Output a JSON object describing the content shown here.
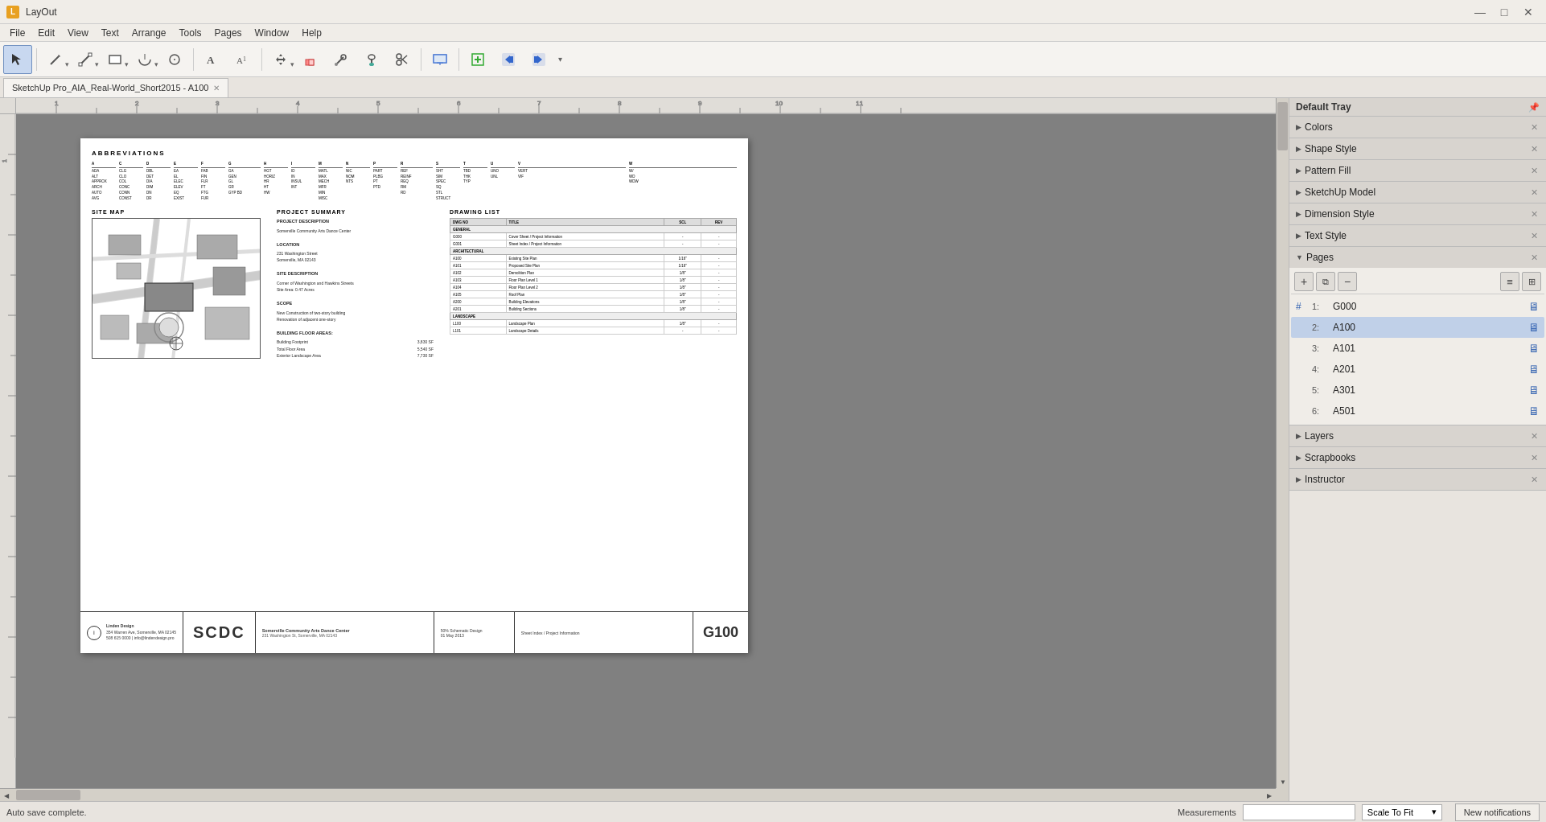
{
  "app": {
    "title": "LayOut",
    "icon_text": "L"
  },
  "window_controls": {
    "minimize": "—",
    "maximize": "□",
    "close": "✕"
  },
  "menu": {
    "items": [
      "File",
      "Edit",
      "View",
      "Text",
      "Arrange",
      "Tools",
      "Pages",
      "Window",
      "Help"
    ]
  },
  "toolbar": {
    "tools": [
      {
        "name": "select-tool",
        "icon": "↖",
        "label": "Select"
      },
      {
        "name": "pencil-tool",
        "icon": "✏",
        "label": "Pencil"
      },
      {
        "name": "line-tool",
        "icon": "╱",
        "label": "Line"
      },
      {
        "name": "shape-tool",
        "icon": "⬜",
        "label": "Shape"
      },
      {
        "name": "arc-tool",
        "icon": "◔",
        "label": "Arc"
      },
      {
        "name": "circle-tool",
        "icon": "◎",
        "label": "Circle"
      },
      {
        "name": "text-tool",
        "icon": "A",
        "label": "Text"
      },
      {
        "name": "text2-tool",
        "icon": "A",
        "label": "Scaled Text"
      },
      {
        "name": "move-tool",
        "icon": "✛",
        "label": "Move"
      },
      {
        "name": "eraser-tool",
        "icon": "▭",
        "label": "Eraser"
      },
      {
        "name": "eyedropper-tool",
        "icon": "✒",
        "label": "Eyedropper"
      },
      {
        "name": "paint-tool",
        "icon": "/",
        "label": "Paint"
      },
      {
        "name": "scissors-tool",
        "icon": "✂",
        "label": "Scissors"
      },
      {
        "name": "screen-tool",
        "icon": "🖥",
        "label": "Screen"
      },
      {
        "name": "insert-tool",
        "icon": "➕",
        "label": "Insert"
      },
      {
        "name": "nav-back",
        "icon": "⬅",
        "label": "Back"
      },
      {
        "name": "nav-forward",
        "icon": "➡",
        "label": "Forward"
      }
    ]
  },
  "tab": {
    "label": "SketchUp Pro_AIA_Real-World_Short2015 - A100",
    "close_icon": "✕"
  },
  "canvas": {
    "background_color": "#808080"
  },
  "right_panel": {
    "title": "Default Tray",
    "pin_icon": "📌",
    "sections": [
      {
        "id": "colors",
        "label": "Colors",
        "expanded": false,
        "arrow": "▶"
      },
      {
        "id": "shape-style",
        "label": "Shape Style",
        "expanded": false,
        "arrow": "▶"
      },
      {
        "id": "pattern-fill",
        "label": "Pattern Fill",
        "expanded": false,
        "arrow": "▶"
      },
      {
        "id": "sketchup-model",
        "label": "SketchUp Model",
        "expanded": false,
        "arrow": "▶"
      },
      {
        "id": "dimension-style",
        "label": "Dimension Style",
        "expanded": false,
        "arrow": "▶"
      },
      {
        "id": "text-style",
        "label": "Text Style",
        "expanded": false,
        "arrow": "▶"
      },
      {
        "id": "pages",
        "label": "Pages",
        "expanded": true,
        "arrow": "▼"
      },
      {
        "id": "layers",
        "label": "Layers",
        "expanded": false,
        "arrow": "▶"
      },
      {
        "id": "scrapbooks",
        "label": "Scrapbooks",
        "expanded": false,
        "arrow": "▶"
      },
      {
        "id": "instructor",
        "label": "Instructor",
        "expanded": false,
        "arrow": "▶"
      }
    ]
  },
  "pages": {
    "toolbar": {
      "add_icon": "+",
      "duplicate_icon": "⧉",
      "remove_icon": "−",
      "list_view_icon": "≡",
      "grid_view_icon": "⊞"
    },
    "items": [
      {
        "num": "1:",
        "label": "G000",
        "active": false,
        "hash": true
      },
      {
        "num": "2:",
        "label": "A100",
        "active": true,
        "hash": false
      },
      {
        "num": "3:",
        "label": "A101",
        "active": false,
        "hash": false
      },
      {
        "num": "4:",
        "label": "A201",
        "active": false,
        "hash": false
      },
      {
        "num": "5:",
        "label": "A301",
        "active": false,
        "hash": false
      },
      {
        "num": "6:",
        "label": "A501",
        "active": false,
        "hash": false
      }
    ],
    "monitor_icon": "🖥"
  },
  "page_document": {
    "abbreviations_title": "ABBREVIATIONS",
    "site_map_title": "SITE MAP",
    "project_summary_title": "PROJECT SUMMARY",
    "drawing_list_title": "DRAWING LIST",
    "title_block": {
      "company_name": "Linden Design",
      "company_address": "354 Warren Ave, Somerville, MA 02145\n508 615 0000 | info@lindendesign.pro",
      "scdc_text": "SCDC",
      "project_name": "Somerville Community Arts Dance Center",
      "project_address": "231 Washington St, Somerville, MA 02143",
      "phase": "50% Schematic Design",
      "date": "01 May 2013",
      "sheet_label": "Sheet Index / Project Information",
      "sheet_number": "G100"
    }
  },
  "status_bar": {
    "auto_save_text": "Auto save complete.",
    "measurements_label": "Measurements",
    "measurements_placeholder": "",
    "scale_label": "Scale To Fit",
    "new_notifications_label": "New notifications"
  }
}
